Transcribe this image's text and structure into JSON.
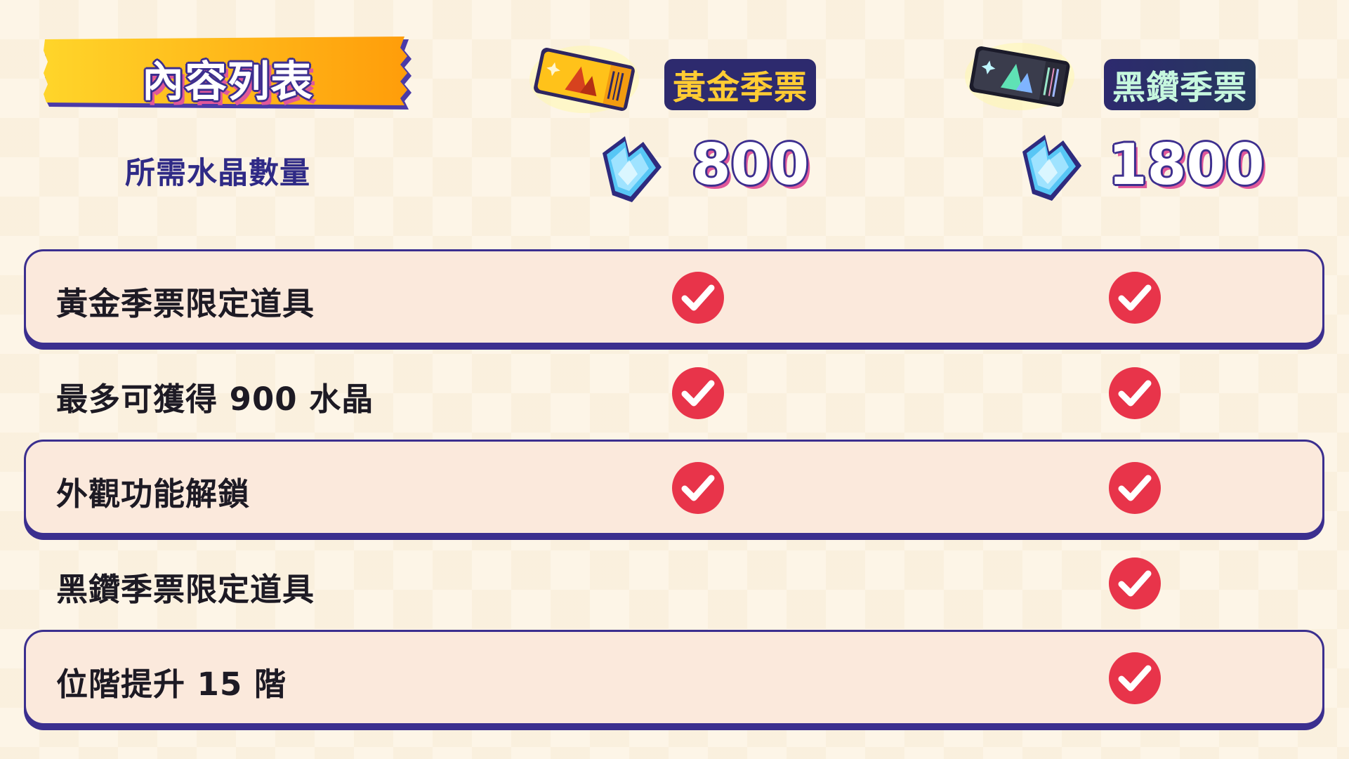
{
  "header": {
    "title": "內容列表",
    "crystal_label": "所需水晶數量"
  },
  "passes": [
    {
      "name": "黃金季票",
      "price": "800",
      "accent": "#ffcc33"
    },
    {
      "name": "黑鑽季票",
      "price": "1800",
      "accent": "#c6f7de"
    }
  ],
  "rows": [
    {
      "label": "黃金季票限定道具",
      "gold": true,
      "black": true,
      "boxed": true
    },
    {
      "label": "最多可獲得 900 水晶",
      "gold": true,
      "black": true,
      "boxed": false
    },
    {
      "label": "外觀功能解鎖",
      "gold": true,
      "black": true,
      "boxed": true
    },
    {
      "label": "黑鑽季票限定道具",
      "gold": false,
      "black": true,
      "boxed": false
    },
    {
      "label": "位階提升 15 階",
      "gold": false,
      "black": true,
      "boxed": true
    }
  ],
  "icons": {
    "check": "check-circle-icon",
    "crystal": "crystal-icon",
    "gold_ticket": "gold-ticket-icon",
    "black_ticket": "black-ticket-icon"
  },
  "colors": {
    "check_red": "#e8344a",
    "outline_purple": "#3b2f8f",
    "banner_orange": "#ffa812"
  }
}
